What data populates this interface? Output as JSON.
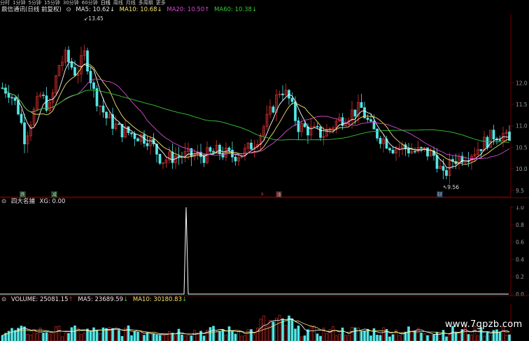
{
  "toolbar": {
    "items": [
      "分时",
      "1分钟",
      "5分钟",
      "15分钟",
      "30分钟",
      "60分钟",
      "日线",
      "周线",
      "月线",
      "多周期",
      "更多"
    ],
    "active": "日线"
  },
  "main_header": {
    "title": "鼎信通讯(日线 前复权)",
    "ma5": "MA5: 10.62",
    "ma5_arrow": "↓",
    "ma10": "MA10: 10.68",
    "ma10_arrow": "↓",
    "ma20": "MA20: 10.50",
    "ma20_arrow": "↑",
    "ma60": "MA60: 10.38",
    "ma60_arrow": "↓"
  },
  "main_axis": [
    "12.0",
    "11.5",
    "11.0",
    "10.5",
    "10.0",
    "9.5"
  ],
  "annotations": {
    "high": "13.45",
    "low": "9.56"
  },
  "signals": [
    {
      "label": "跌",
      "color": "#33c033"
    },
    {
      "label": "减",
      "color": "#33c033"
    },
    {
      "label": "s",
      "color": "#e04040"
    },
    {
      "label": "涨",
      "color": "#e04040"
    },
    {
      "label": "财",
      "color": "#3a7fd0"
    }
  ],
  "indicator": {
    "title": "四大名捕",
    "xg": "XG: 0.00",
    "axis": [
      "1.0",
      "0.8",
      "0.6",
      "0.4",
      "0.2",
      "0.0"
    ]
  },
  "volume_header": {
    "vol": "VOLUME: 25081.15",
    "vol_arrow": "↑",
    "ma5": "MA5: 23689.59",
    "ma5_arrow": "↓",
    "ma10": "MA10: 30180.83",
    "ma10_arrow": "↓"
  },
  "watermark": "www.7gpzb.com",
  "colors": {
    "up": "#e03232",
    "down": "#54e6e6",
    "ma5": "#ffffff",
    "ma10": "#f2e26b",
    "ma20": "#d64bd6",
    "ma60": "#37c837",
    "grid": "#6a0000"
  }
}
